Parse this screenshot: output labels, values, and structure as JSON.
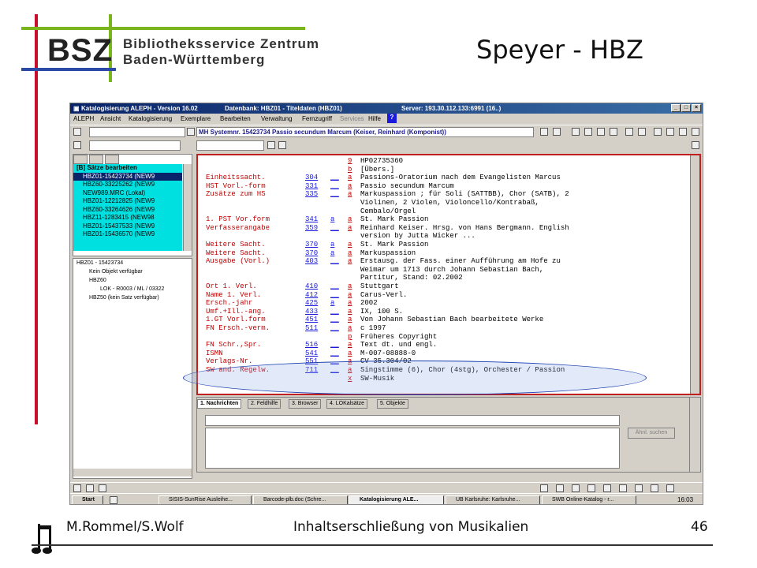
{
  "slide": {
    "logo_text": "BSZ",
    "org_line1": "Bibliotheksservice Zentrum",
    "org_line2": "Baden-Württemberg",
    "title": "Speyer - HBZ",
    "footer_left": "M.Rommel/S.Wolf",
    "footer_center": "Inhaltserschließung von Musikalien",
    "page_number": "46"
  },
  "window": {
    "title": "Katalogisierung ALEPH - Version 16.02",
    "database": "Datenbank: HBZ01 - Titeldaten (HBZ01)",
    "server": "Server: 193.30.112.133:6991 (16..)",
    "minimize": "_",
    "maximize": "□",
    "close": "×"
  },
  "menu": [
    "ALEPH",
    "Ansicht",
    "Katalogisierung",
    "Exemplare",
    "Bearbeiten",
    "Verwaltung",
    "Fernzugriff",
    "Services",
    "Hilfe"
  ],
  "toolbar": {
    "record_header": "MH Systemnr. 15423734 Passio secundum Marcum (Keiser, Reinhard (Komponist))"
  },
  "nav": {
    "root_label": "[B] Sätze bearbeiten",
    "items": [
      "HBZ01-15423734 (NEW9",
      "HBZ60-33225262 (NEW9",
      "NEW989.MRC (Lokal)",
      "HBZ01-12212825 (NEW9",
      "HBZ60-33264626 (NEW9",
      "HBZ11-1283415 (NEW98",
      "HBZ01-15437533 (NEW9",
      "HBZ01-15436570 (NEW9"
    ]
  },
  "tree": {
    "root": "HBZ01 - 15423734",
    "no_object": "Kein Objekt verfügbar",
    "hbz60": "HBZ60",
    "lok": "LOK - R0003 / ML / 03322",
    "hbz50": "HBZ50 (kein Satz verfügbar)"
  },
  "record": [
    {
      "label": "",
      "tag": "",
      "ind": "",
      "sub": "9",
      "value": "HP02735360"
    },
    {
      "label": "",
      "tag": "",
      "ind": "",
      "sub": "b",
      "value": "[Übers.]"
    },
    {
      "label": "Einheitssacht.",
      "tag": "304",
      "ind": "__",
      "sub": "a",
      "value": "Passions-Oratorium nach dem Evangelisten Marcus"
    },
    {
      "label": "HST Vorl.-form",
      "tag": "331",
      "ind": "__",
      "sub": "a",
      "value": "Passio secundum Marcum"
    },
    {
      "label": "Zusätze zum HS",
      "tag": "335",
      "ind": "__",
      "sub": "a",
      "value": "Markuspassion ; für Soli (SATTBB), Chor (SATB), 2"
    },
    {
      "label": "",
      "tag": "",
      "ind": "",
      "sub": "",
      "value": "Violinen, 2 Violen, Violoncello/Kontrabaß,"
    },
    {
      "label": "",
      "tag": "",
      "ind": "",
      "sub": "",
      "value": "Cembalo/Orgel"
    },
    {
      "label": "1. PST Vor.form",
      "tag": "341",
      "ind": "a",
      "sub": "a",
      "value": "St. Mark Passion"
    },
    {
      "label": "Verfasserangabe",
      "tag": "359",
      "ind": "__",
      "sub": "a",
      "value": "Reinhard Keiser. Hrsg. von Hans Bergmann. English"
    },
    {
      "label": "",
      "tag": "",
      "ind": "",
      "sub": "",
      "value": "version by Jutta Wicker ..."
    },
    {
      "label": "Weitere Sacht.",
      "tag": "370",
      "ind": "a",
      "sub": "a",
      "value": "St. Mark Passion"
    },
    {
      "label": "Weitere Sacht.",
      "tag": "370",
      "ind": "a",
      "sub": "a",
      "value": "Markuspassion"
    },
    {
      "label": "Ausgabe (Vorl.)",
      "tag": "403",
      "ind": "__",
      "sub": "a",
      "value": "Erstausg. der Fass. einer Aufführung am Hofe zu"
    },
    {
      "label": "",
      "tag": "",
      "ind": "",
      "sub": "",
      "value": "Weimar um 1713 durch Johann Sebastian Bach,"
    },
    {
      "label": "",
      "tag": "",
      "ind": "",
      "sub": "",
      "value": "Partitur, Stand: 02.2002"
    },
    {
      "label": "Ort 1. Verl.",
      "tag": "410",
      "ind": "__",
      "sub": "a",
      "value": "Stuttgart"
    },
    {
      "label": "Name 1. Verl.",
      "tag": "412",
      "ind": "__",
      "sub": "a",
      "value": "Carus-Verl."
    },
    {
      "label": "Ersch.-jahr",
      "tag": "425",
      "ind": "a",
      "sub": "a",
      "value": "2002"
    },
    {
      "label": "Umf.+Ill.-ang.",
      "tag": "433",
      "ind": "__",
      "sub": "a",
      "value": "IX, 100 S."
    },
    {
      "label": "1.GT Vorl.form",
      "tag": "451",
      "ind": "__",
      "sub": "a",
      "value": "Von Johann Sebastian Bach bearbeitete Werke"
    },
    {
      "label": "FN Ersch.-verm.",
      "tag": "511",
      "ind": "__",
      "sub": "a",
      "value": "c 1997"
    },
    {
      "label": "",
      "tag": "",
      "ind": "",
      "sub": "p",
      "value": "Früheres Copyright"
    },
    {
      "label": "FN Schr.,Spr.",
      "tag": "516",
      "ind": "__",
      "sub": "a",
      "value": "Text dt. und engl."
    },
    {
      "label": "ISMN",
      "tag": "541",
      "ind": "__",
      "sub": "a",
      "value": "M-007-08888-0"
    },
    {
      "label": "Verlags-Nr.",
      "tag": "551",
      "ind": "__",
      "sub": "a",
      "value": "CV 35.304/02"
    },
    {
      "label": "SW and. Regelw.",
      "tag": "711",
      "ind": "__",
      "sub": "a",
      "value": "Singstimme (6), Chor (4stg), Orchester / Passion"
    },
    {
      "label": "",
      "tag": "",
      "ind": "",
      "sub": "x",
      "value": "SW-Musik"
    }
  ],
  "bottom_tabs": [
    "1. Nachrichten",
    "2. Feldhilfe",
    "3. Browser",
    "4. LOKalsätze",
    "5. Objekte"
  ],
  "bottom": {
    "search_button": "Ähnl. suchen"
  },
  "taskbar": {
    "start": "Start",
    "tasks": [
      "SISIS-SunRise Ausleihe...",
      "Barcode-plb.doc (Schre...",
      "Katalogisierung ALE...",
      "UB Karlsruhe: Karlsruhe...",
      "SWB Online-Katalog - r..."
    ],
    "clock": "16:03"
  },
  "colors": {
    "accent_red": "#c8102e",
    "accent_green": "#7ab51d",
    "accent_blue": "#2b4aa6",
    "nav_highlight": "#00e0e0"
  }
}
